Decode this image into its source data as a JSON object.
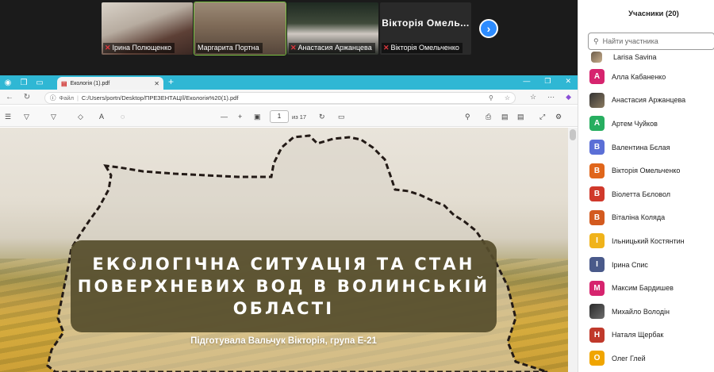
{
  "gallery": {
    "tiles": [
      {
        "name": "Ірина Полющенко"
      },
      {
        "name": "Маргарита Портна"
      },
      {
        "name": "Анастасия Аржанцева"
      },
      {
        "name": "Вікторія Омельченко",
        "card_label": "Вікторія Омель..."
      }
    ],
    "next_icon": "chevron-right-icon"
  },
  "browser": {
    "tab_title": "Екологія (1).pdf",
    "address_label": "Файл",
    "address_url": "C:/Users/portn/Desktop/ПРЕЗЕНТАЦІЇ/Екологія%20(1).pdf",
    "page_current": "1",
    "page_total": "из 17"
  },
  "slide": {
    "title": "ЕКОЛОГІЧНА СИТУАЦІЯ ТА СТАН ПОВЕРХНЕВИХ ВОД В ВОЛИНСЬКІЙ ОБЛАСТІ",
    "subtitle": "Підготувала Вальчук Вікторія, група Е-21"
  },
  "panel": {
    "title": "Учасники (20)",
    "search_placeholder": "Найти участника",
    "participants": [
      {
        "name": "Larisa Savina",
        "initial": "",
        "color": "photo"
      },
      {
        "name": "Алла Кабаненко",
        "initial": "А",
        "color": "#d6246e"
      },
      {
        "name": "Анастасия Аржанцева",
        "initial": "",
        "color": "photo2"
      },
      {
        "name": "Артем Чуйков",
        "initial": "А",
        "color": "#27ae60"
      },
      {
        "name": "Валентина Бєлая",
        "initial": "В",
        "color": "#5b6fd6"
      },
      {
        "name": "Вікторія Омельченко",
        "initial": "В",
        "color": "#e0661b"
      },
      {
        "name": "Віолетта Бєловол",
        "initial": "В",
        "color": "#d0392b"
      },
      {
        "name": "Віталіна Коляда",
        "initial": "В",
        "color": "#d35a1f"
      },
      {
        "name": "Ільницький Костянтин",
        "initial": "І",
        "color": "#f0b31a"
      },
      {
        "name": "Ірина Спис",
        "initial": "І",
        "color": "#4a5a8a"
      },
      {
        "name": "Максим Бардишев",
        "initial": "М",
        "color": "#d6246e"
      },
      {
        "name": "Михайло Володін",
        "initial": "",
        "color": "photo3"
      },
      {
        "name": "Наталя Щербак",
        "initial": "Н",
        "color": "#c0392b"
      },
      {
        "name": "Олег Глей",
        "initial": "О",
        "color": "#f0a500"
      }
    ]
  }
}
